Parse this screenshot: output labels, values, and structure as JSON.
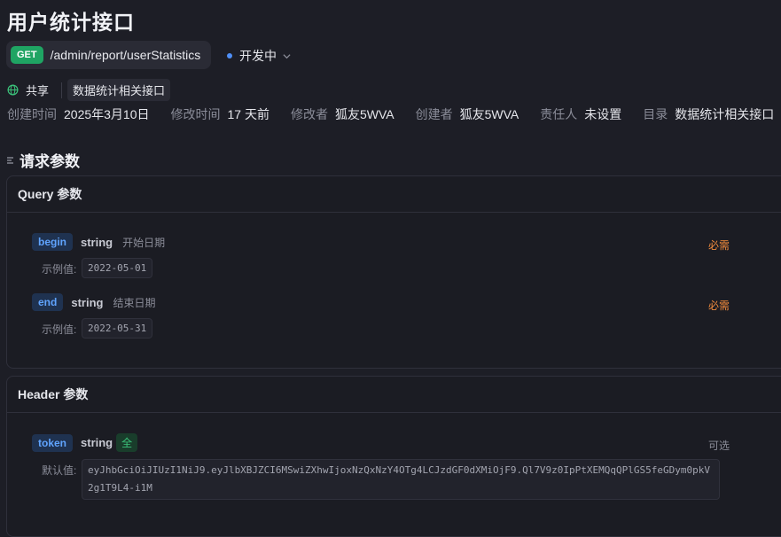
{
  "title": "用户统计接口",
  "request": {
    "method": "GET",
    "path": "/admin/report/userStatistics",
    "status": "开发中"
  },
  "share": {
    "label": "共享",
    "tag": "数据统计相关接口"
  },
  "meta": [
    {
      "key": "创建时间",
      "value": "2025年3月10日"
    },
    {
      "key": "修改时间",
      "value": "17 天前"
    },
    {
      "key": "修改者",
      "value": "狐友5WVA"
    },
    {
      "key": "创建者",
      "value": "狐友5WVA"
    },
    {
      "key": "责任人",
      "value": "未设置"
    },
    {
      "key": "目录",
      "value": "数据统计相关接口"
    }
  ],
  "section_title": "请求参数",
  "query": {
    "title": "Query 参数",
    "params": [
      {
        "name": "begin",
        "type": "string",
        "desc": "开始日期",
        "required": "必需",
        "example_label": "示例值:",
        "example": "2022-05-01"
      },
      {
        "name": "end",
        "type": "string",
        "desc": "结束日期",
        "required": "必需",
        "example_label": "示例值:",
        "example": "2022-05-31"
      }
    ]
  },
  "header": {
    "title": "Header 参数",
    "params": [
      {
        "name": "token",
        "type": "string",
        "badge": "全",
        "optional": "可选",
        "default_label": "默认值:",
        "default": "eyJhbGciOiJIUzI1NiJ9.eyJlbXBJZCI6MSwiZXhwIjoxNzQxNzY4OTg4LCJzdGF0dXMiOjF9.Ql7V9z0IpPtXEMQqQPlGS5feGDym0pkV2g1T9L4-i1M"
      }
    ]
  },
  "colors": {
    "accent": "#4f8ff7",
    "get": "#1fa463",
    "required": "#f08a3c"
  }
}
